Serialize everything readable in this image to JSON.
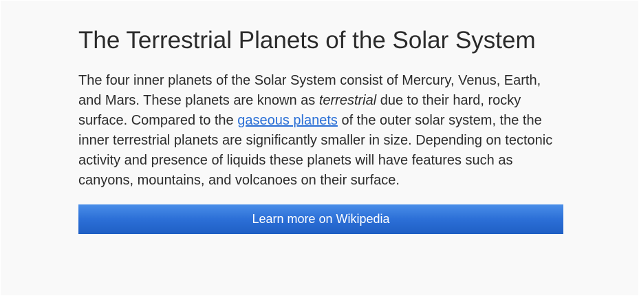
{
  "article": {
    "title": "The Terrestrial Planets of the Solar System",
    "paragraph": {
      "text_before_italic": "The four inner planets of the Solar System consist of Mercury, Venus, Earth, and Mars. These planets are known as ",
      "italic_word": "terrestrial",
      "text_after_italic": " due to their hard, rocky surface. Compared to the ",
      "link_text": "gaseous planets",
      "text_after_link": " of the outer solar system, the the inner terrestrial planets are significantly smaller in size. Depending on tectonic activity and presence of liquids these planets will have features such as canyons, mountains, and volcanoes on their surface."
    },
    "cta_label": "Learn more on Wikipedia"
  },
  "colors": {
    "page_background": "#f9f9f9",
    "text": "#2b2b2b",
    "link": "#2a6fd6",
    "button": "#2c6fd7",
    "button_text": "#ffffff"
  }
}
